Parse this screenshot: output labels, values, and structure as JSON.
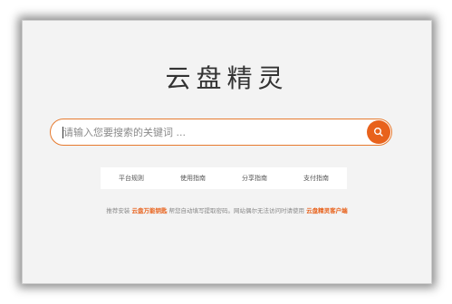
{
  "brand": {
    "logo_text": "云盘精灵"
  },
  "search": {
    "placeholder": "请输入您要搜索的关键词 ...",
    "button_icon": "search-icon",
    "accent_color": "#e8621c"
  },
  "tabs": [
    {
      "label": "平台规则"
    },
    {
      "label": "使用指南"
    },
    {
      "label": "分享指南"
    },
    {
      "label": "支付指南"
    }
  ],
  "notice": {
    "prefix": "推荐安装",
    "link1": "云盘万能钥匙",
    "middle": "帮您自动填写提取密码。网站偶尔无法访问时请使用",
    "link2": "云盘精灵客户端"
  }
}
